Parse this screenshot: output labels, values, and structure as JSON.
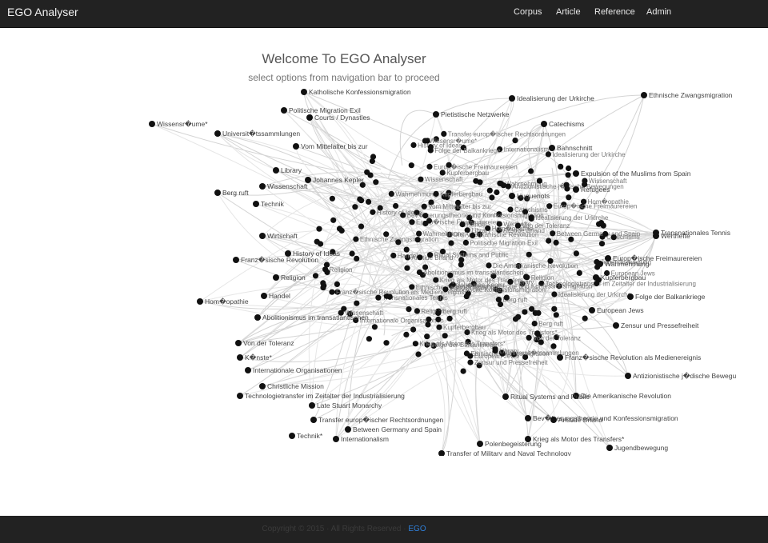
{
  "navbar": {
    "brand": "EGO Analyser",
    "links": [
      "Corpus",
      "Article",
      "Reference",
      "Admin"
    ]
  },
  "welcome": {
    "title": "Welcome To EGO Analyser",
    "subtitle": "select options from navigation bar to proceed"
  },
  "graph": {
    "node_labels": [
      "Katholische Konfessionsmigration",
      "Idealisierung der Urkirche",
      "Ethnische Zwangsmigration",
      "Politische Migration Exil",
      "Courts / Dynasties",
      "Wissensr�ume*",
      "Universit�tssammlungen",
      "Vom Mittelalter bis zur",
      "Wissenschaft",
      "Library",
      "Johannes Kepler",
      "Berg ruft",
      "Technik",
      "Wirtschaft",
      "Franz�sische Revolution",
      "Religion",
      "History of Ideas",
      "Hom�opathie",
      "Handel",
      "Abolitionismus im transatlantischen",
      "Von der Toleranz",
      "K�nste*",
      "Internationale Organisationen",
      "Christliche Mission",
      "Technologietransfer im Zeitalter der Industrialisierung",
      "Late Stuart Monarchy",
      "Transfer europ�ischer Rechtsordnungen",
      "Between Germany and Spain",
      "Technik*",
      "Internationalism",
      "Polenbegeisterung",
      "Transfer of Military and Naval Technology",
      "Jugendbewegung",
      "Krieg als Motor des Transfers*",
      "Bev�lkerungstheorie und Konfessionsmigration",
      "Aristide Briand",
      "Die Amerikanische Revolution",
      "Ritual Systems and Public",
      "Antizionistische j�dische Bewegungen",
      "Franz�sische Revolution als Medienereignis",
      "Zensur und Pressefreiheit",
      "Folge der Balkankriege",
      "European Jews",
      "Kupferbergbau",
      "Wahrnehmung",
      "Europ�ische Freimaurereien",
      "Werthefte",
      "Transnationales Tennis",
      "Refugees",
      "Huguenots",
      "Expulsion of the Muslims from Spain",
      "Catechisms",
      "Pietistische Netzwerke",
      "Bahnschnitt"
    ]
  },
  "footer": {
    "copyright": "Copyright © 2015 · All Rights Reserved ·",
    "link": "EGO"
  }
}
